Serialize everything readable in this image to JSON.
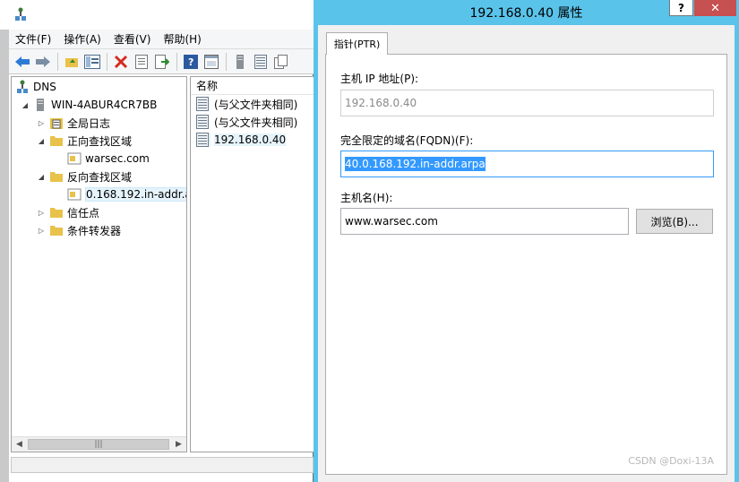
{
  "manager": {
    "menu": [
      "文件(F)",
      "操作(A)",
      "查看(V)",
      "帮助(H)"
    ],
    "toolbar_icons": [
      "back-arrow-icon",
      "forward-arrow-icon",
      "up-folder-icon",
      "show-hide-tree-icon",
      "delete-icon",
      "properties-icon",
      "export-icon",
      "help-icon",
      "console-icon",
      "server-icon",
      "list-icon",
      "copy-icon"
    ],
    "tree": {
      "root": "DNS",
      "server": "WIN-4ABUR4CR7BB",
      "global_log": "全局日志",
      "forward_zones": "正向查找区域",
      "forward_zone_item": "warsec.com",
      "reverse_zones": "反向查找区域",
      "reverse_zone_item": "0.168.192.in-addr.a",
      "trust_points": "信任点",
      "conditional_forwarders": "条件转发器"
    },
    "list": {
      "header": "名称",
      "rows": [
        "(与父文件夹相同)",
        "(与父文件夹相同)",
        "192.168.0.40"
      ]
    }
  },
  "dialog": {
    "title": "192.168.0.40 属性",
    "help_label": "?",
    "close_label": "✕",
    "tab_label": "指针(PTR)",
    "host_ip_label": "主机 IP 地址(P):",
    "host_ip_value": "192.168.0.40",
    "fqdn_label": "完全限定的域名(FQDN)(F):",
    "fqdn_value": "40.0.168.192.in-addr.arpa",
    "hostname_label": "主机名(H):",
    "hostname_value": "www.warsec.com",
    "browse_label": "浏览(B)..."
  },
  "watermark": "CSDN @Doxi-13A",
  "colors": {
    "title_bar_accent": "#5ac3ea",
    "close_button": "#c75050",
    "selection": "#3399ff"
  }
}
